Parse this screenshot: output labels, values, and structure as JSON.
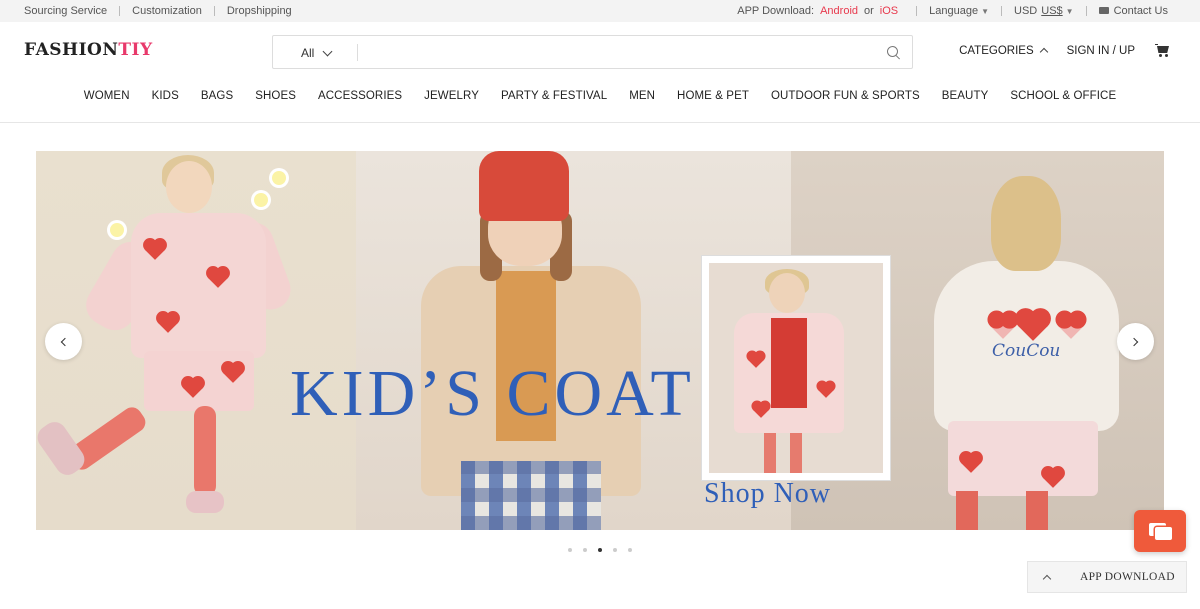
{
  "topbar": {
    "links": [
      "Sourcing Service",
      "Customization",
      "Dropshipping"
    ],
    "app_download_label": "APP Download:",
    "android": "Android",
    "or": "or",
    "ios": "iOS",
    "language": "Language",
    "currency_prefix": "USD",
    "currency": "US$",
    "contact": "Contact Us"
  },
  "header": {
    "logo_main": "FASHION",
    "logo_accent": "TIY",
    "search_category": "All",
    "search_placeholder": "",
    "categories": "CATEGORIES",
    "signin": "SIGN IN / UP"
  },
  "nav": [
    "WOMEN",
    "KIDS",
    "BAGS",
    "SHOES",
    "ACCESSORIES",
    "JEWELRY",
    "PARTY & FESTIVAL",
    "MEN",
    "HOME & PET",
    "OUTDOOR FUN & SPORTS",
    "BEAUTY",
    "SCHOOL & OFFICE"
  ],
  "banner": {
    "headline": "KID’S COAT",
    "cta": "Shop Now",
    "coat_text": "CouCou",
    "slides_total": 5,
    "active_slide": 3
  },
  "widgets": {
    "app_download": "APP DOWNLOAD"
  },
  "colors": {
    "accent": "#e8394d",
    "headline": "#2f5fb8",
    "chat": "#ef5a3b"
  }
}
